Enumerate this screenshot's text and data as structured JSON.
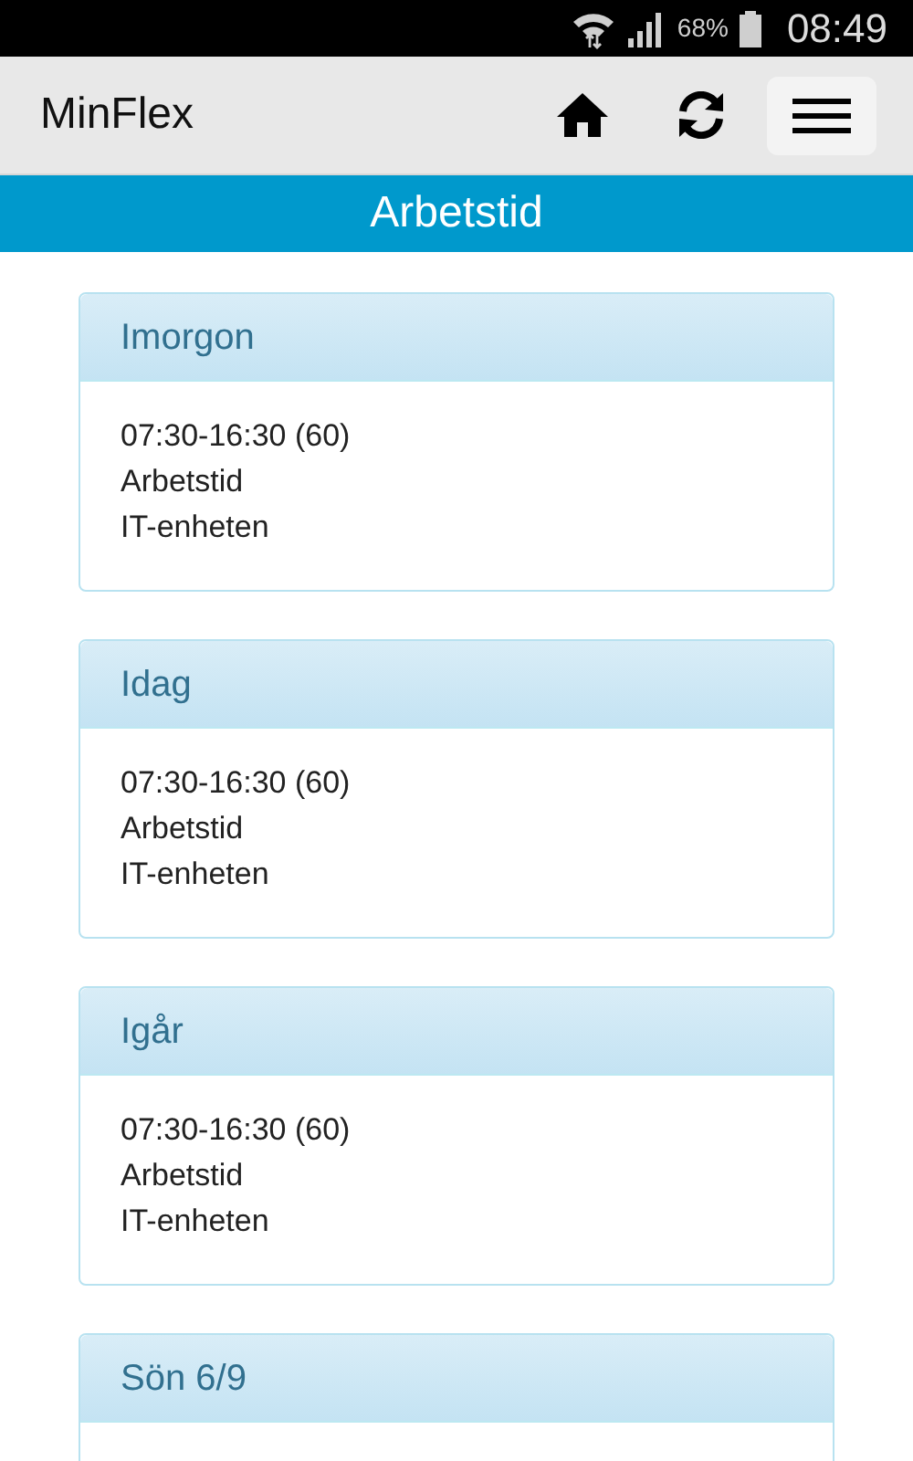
{
  "status_bar": {
    "battery": "68%",
    "time": "08:49"
  },
  "app_bar": {
    "title": "MinFlex"
  },
  "page_title": "Arbetstid",
  "days": [
    {
      "title": "Imorgon",
      "lines": [
        "07:30-16:30 (60)",
        "Arbetstid",
        "IT-enheten"
      ]
    },
    {
      "title": "Idag",
      "lines": [
        "07:30-16:30 (60)",
        "Arbetstid",
        "IT-enheten"
      ]
    },
    {
      "title": "Igår",
      "lines": [
        "07:30-16:30 (60)",
        "Arbetstid",
        "IT-enheten"
      ]
    },
    {
      "title": "Sön 6/9"
    }
  ]
}
